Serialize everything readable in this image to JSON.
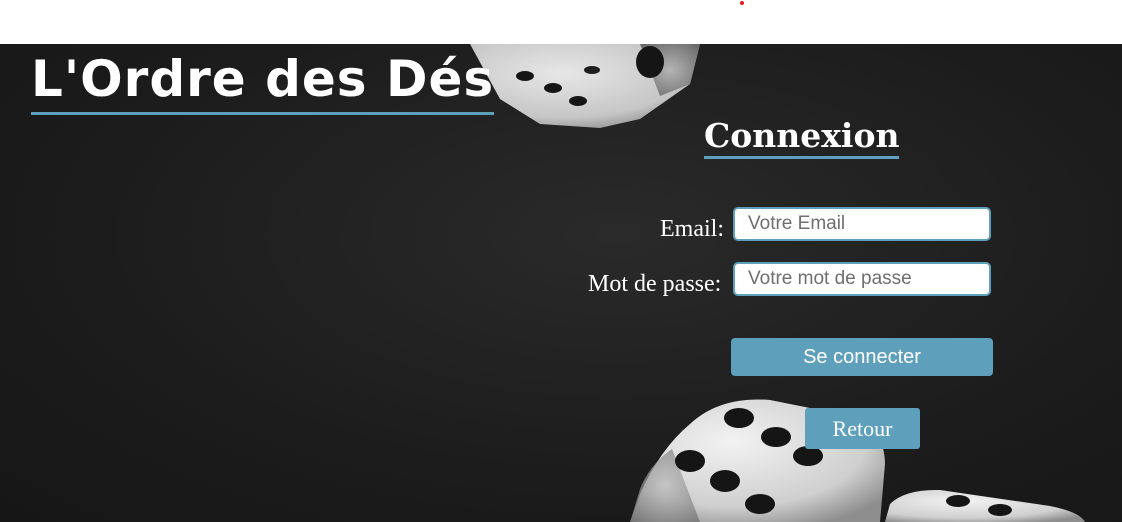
{
  "site": {
    "title": "L'Ordre des Dés"
  },
  "login": {
    "heading": "Connexion",
    "email_label": "Email:",
    "email_placeholder": "Votre Email",
    "email_value": "",
    "password_label": "Mot de passe:",
    "password_placeholder": "Votre mot de passe",
    "password_value": "",
    "submit_label": "Se connecter",
    "back_label": "Retour"
  },
  "icons": {
    "background": "dice-background-image",
    "top_marker": "red-dot-marker"
  },
  "colors": {
    "accent": "#5e9fbc",
    "text": "#ffffff",
    "background": "#1c1c1c",
    "marker": "#e02020"
  }
}
